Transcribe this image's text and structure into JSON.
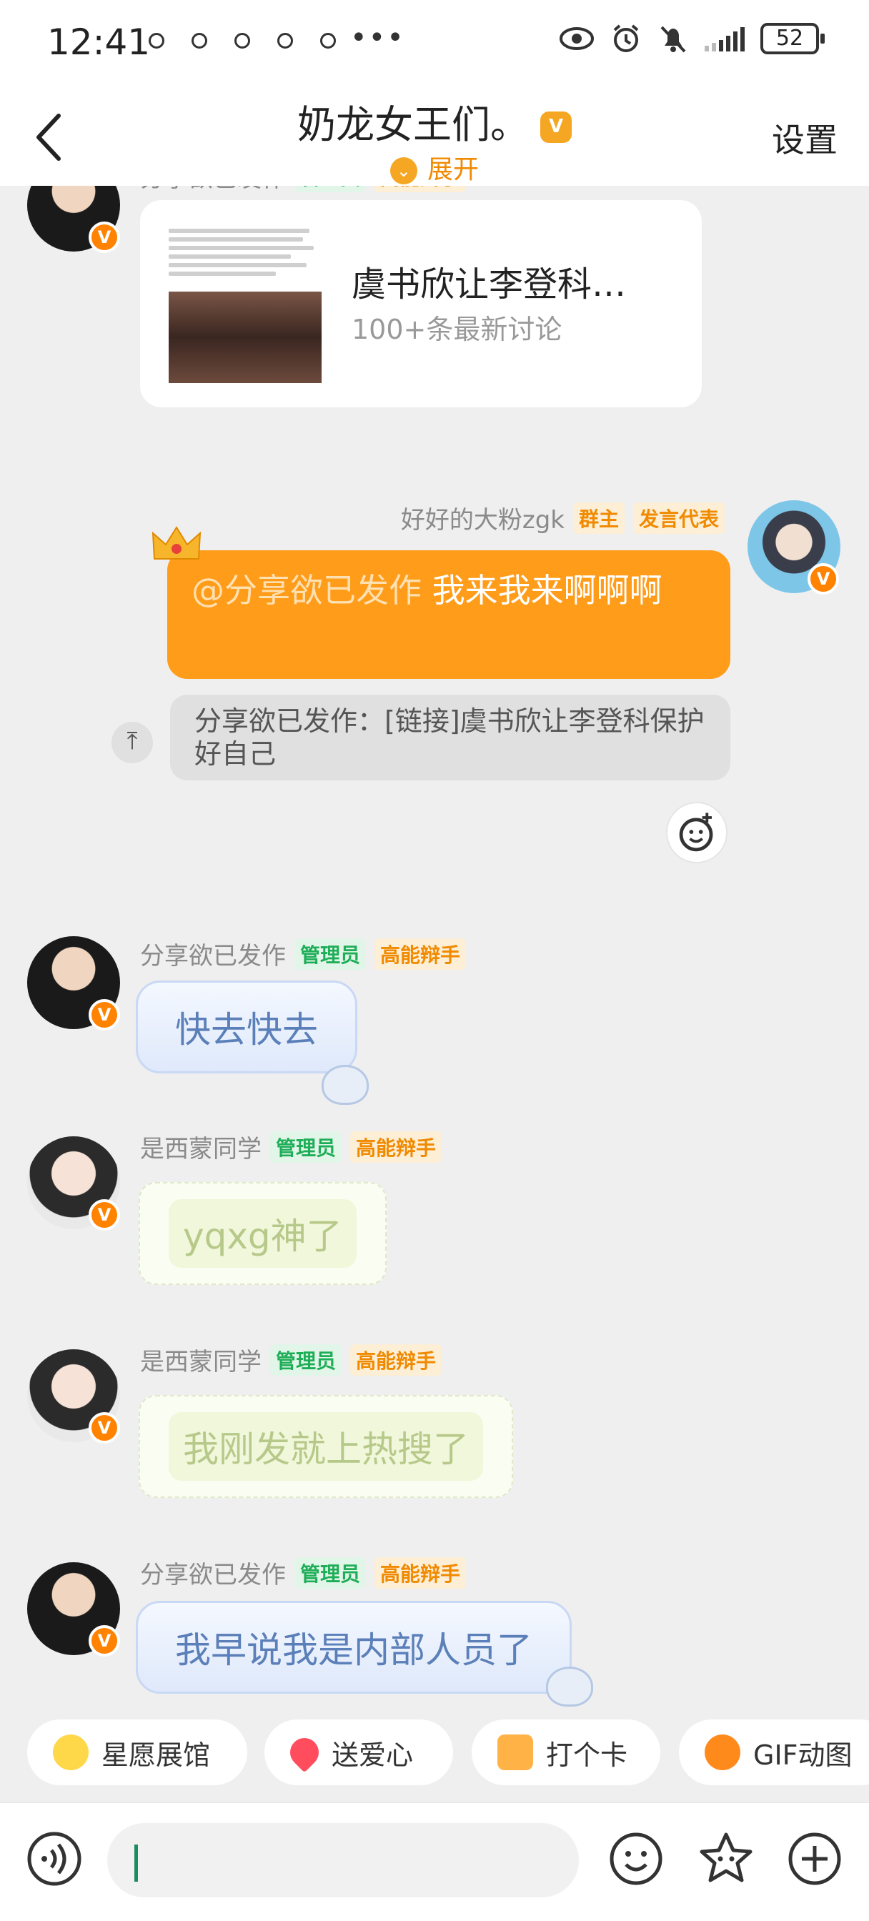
{
  "status_bar": {
    "time": "12:41",
    "more": "•••",
    "battery": "52"
  },
  "header": {
    "title": "奶龙女王们。",
    "expand_label": "展开",
    "settings_label": "设置"
  },
  "messages": [
    {
      "user": "分享欲已发作",
      "tags": [
        "管理员",
        "高能辩手"
      ],
      "type": "card",
      "card_title": "虞书欣让李登科…",
      "card_sub": "100+条最新讨论"
    },
    {
      "user": "好好的大粉zgk",
      "tags": [
        "群主",
        "发言代表"
      ],
      "type": "reply",
      "mention": "@分享欲已发作",
      "text": "我来我来啊啊啊",
      "quote": "分享欲已发作：[链接]虞书欣让李登科保护好自己"
    },
    {
      "user": "分享欲已发作",
      "tags": [
        "管理员",
        "高能辩手"
      ],
      "type": "text",
      "text": "快去快去"
    },
    {
      "user": "是西蒙同学",
      "tags": [
        "管理员",
        "高能辩手"
      ],
      "type": "text",
      "text": "yqxg神了"
    },
    {
      "user": "是西蒙同学",
      "tags": [
        "管理员",
        "高能辩手"
      ],
      "type": "text",
      "text": "我刚发就上热搜了"
    },
    {
      "user": "分享欲已发作",
      "tags": [
        "管理员",
        "高能辩手"
      ],
      "type": "text",
      "text": "我早说我是内部人员了"
    }
  ],
  "quick_actions": [
    "星愿展馆",
    "送爱心",
    "打个卡",
    "GIF动图"
  ],
  "input": {
    "value": ""
  },
  "colors": {
    "accent": "#ff9c1a",
    "admin_tag": "#1fae58",
    "debate_tag": "#f08a00"
  }
}
